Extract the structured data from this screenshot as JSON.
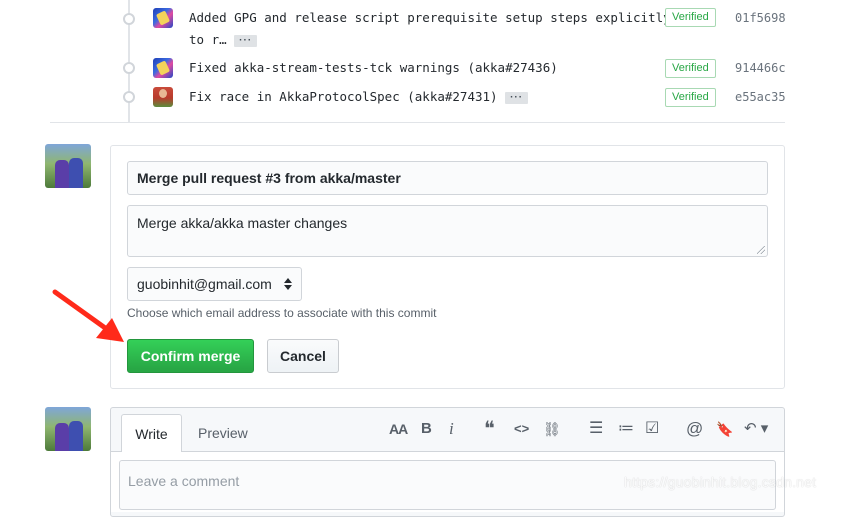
{
  "commits": [
    {
      "message": "Added GPG and release script prerequisite setup steps explicitly",
      "message_cont": "to r…",
      "verified": "Verified",
      "sha": "01f5698",
      "avatar": "bot-avatar"
    },
    {
      "message": "Fixed akka-stream-tests-tck warnings (akka#27436)",
      "verified": "Verified",
      "sha": "914466c",
      "avatar": "bot-avatar"
    },
    {
      "message": "Fix race in AkkaProtocolSpec (akka#27431)",
      "verified": "Verified",
      "sha": "e55ac35",
      "avatar": "user-avatar"
    }
  ],
  "ellipsis": "···",
  "merge": {
    "title": "Merge pull request #3 from akka/master",
    "body": "Merge akka/akka master changes",
    "email": "guobinhit@gmail.com",
    "email_note": "Choose which email address to associate with this commit",
    "confirm_label": "Confirm merge",
    "cancel_label": "Cancel",
    "confirm_color": "#28a745"
  },
  "comment": {
    "tab_write": "Write",
    "tab_preview": "Preview",
    "placeholder": "Leave a comment",
    "toolbar": {
      "header": "AA",
      "bold": "B",
      "italic": "i",
      "quote": "❝",
      "code": "<>",
      "link": "⛓",
      "unordered_list": "☰",
      "ordered_list": "≔",
      "task_list": "☑",
      "mention": "@",
      "reference": "🔖",
      "reply": "↶ ▾"
    }
  },
  "watermark": "https://guobinhit.blog.csdn.net",
  "annotation_color": "#ff2a1a"
}
